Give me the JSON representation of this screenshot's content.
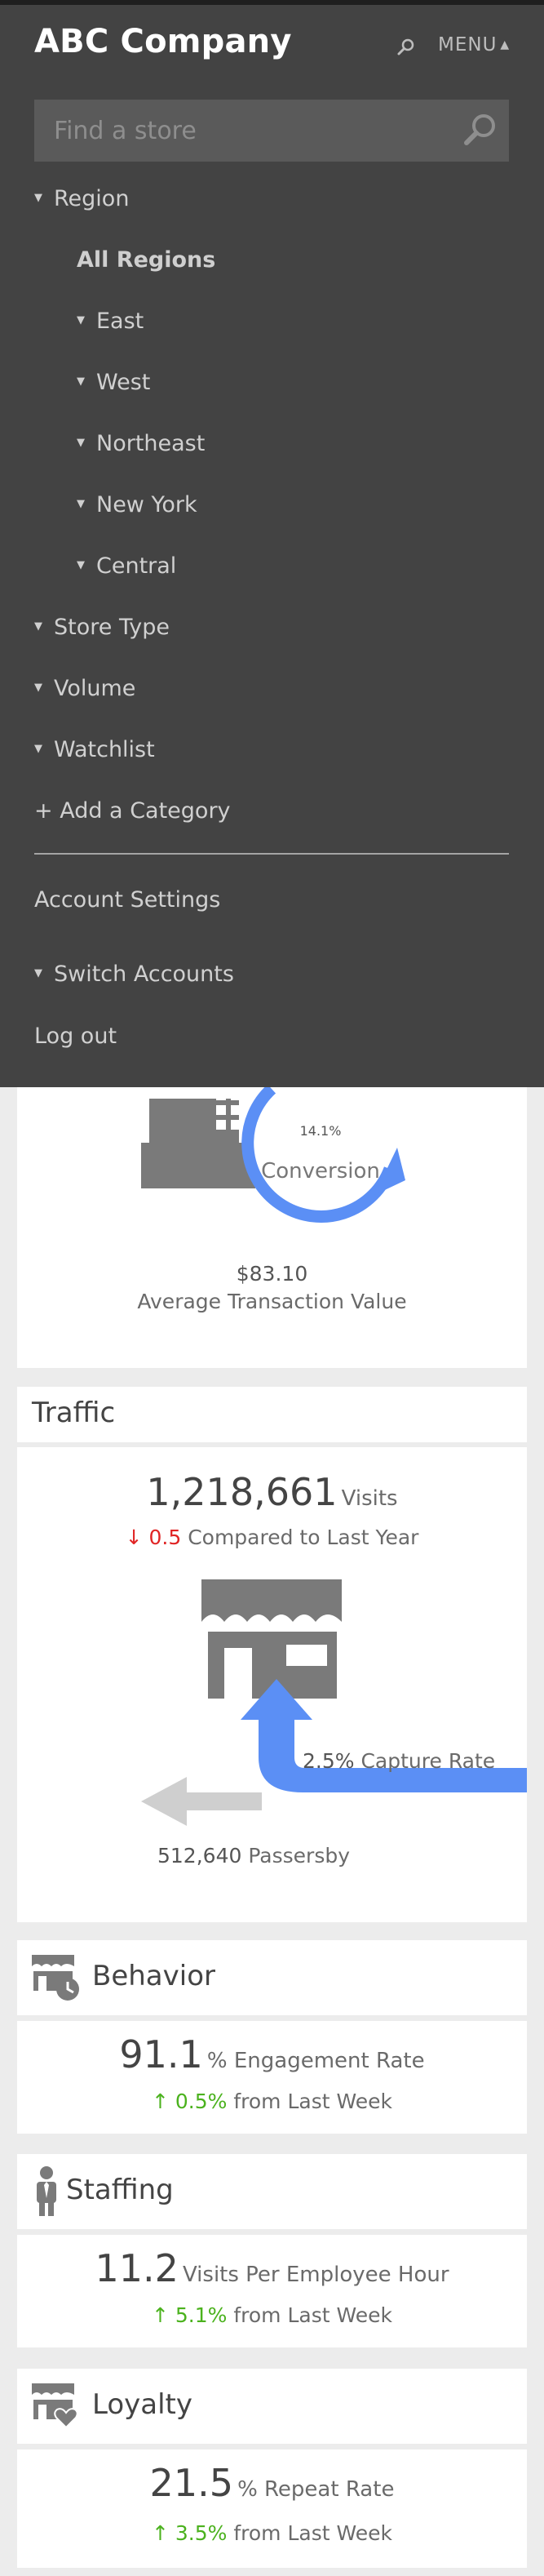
{
  "header": {
    "brand": "ABC Company",
    "search_icon": "search-icon",
    "menu_label": "MENU",
    "menu_caret": "▲"
  },
  "menu": {
    "search_placeholder": "Find a store",
    "region": {
      "label": "Region",
      "items": [
        "All Regions",
        "East",
        "West",
        "Northeast",
        "New York",
        "Central"
      ]
    },
    "categories": [
      "Store Type",
      "Volume",
      "Watchlist"
    ],
    "add_category": "+ Add a Category",
    "account_settings": "Account Settings",
    "switch_accounts": "Switch Accounts",
    "log_out": "Log out"
  },
  "conversion": {
    "percent": "14.1%",
    "label": "Conversion",
    "atv_value": "$83.10",
    "atv_label": "Average Transaction Value"
  },
  "traffic": {
    "title": "Traffic",
    "visits": "1,218,661",
    "visits_unit": "Visits",
    "change": "0.5",
    "change_label": "Compared to Last Year",
    "capture_pct": "2.5%",
    "capture_label": "Capture Rate",
    "passersby": "512,640",
    "passersby_label": "Passersby"
  },
  "behavior": {
    "title": "Behavior",
    "value": "91.1",
    "unit": "% Engagement Rate",
    "change": "0.5%",
    "change_label": "from Last Week"
  },
  "staffing": {
    "title": "Staffing",
    "value": "11.2",
    "unit": "Visits Per Employee Hour",
    "change": "5.1%",
    "change_label": "from Last Week"
  },
  "loyalty": {
    "title": "Loyalty",
    "value": "21.5",
    "unit": "% Repeat Rate",
    "change": "3.5%",
    "change_label": "from Last Week"
  },
  "colors": {
    "menu_bg": "#434343",
    "accent_blue": "#5b8ff5",
    "icon_gray": "#7a7a7a",
    "positive_green": "#4bb21e",
    "negative_red": "#e02424"
  }
}
